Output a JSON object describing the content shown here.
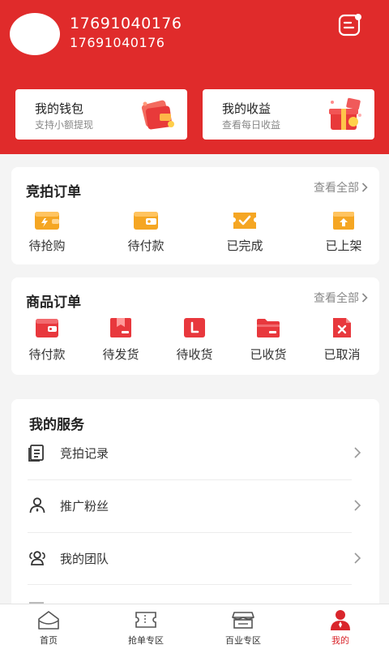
{
  "header": {
    "username": "17691040176",
    "phone": "17691040176"
  },
  "wallet": {
    "title": "我的钱包",
    "subtitle": "支持小额提现"
  },
  "earnings": {
    "title": "我的收益",
    "subtitle": "查看每日收益"
  },
  "auction_orders": {
    "title": "竞拍订单",
    "see_all": "查看全部",
    "items": [
      {
        "label": "待抢购",
        "icon": "wallet-clock-icon"
      },
      {
        "label": "待付款",
        "icon": "wallet-icon"
      },
      {
        "label": "已完成",
        "icon": "check-ticket-icon"
      },
      {
        "label": "已上架",
        "icon": "box-upload-icon"
      }
    ]
  },
  "product_orders": {
    "title": "商品订单",
    "see_all": "查看全部",
    "items": [
      {
        "label": "待付款",
        "icon": "wallet-icon"
      },
      {
        "label": "待发货",
        "icon": "package-icon"
      },
      {
        "label": "待收货",
        "icon": "receive-box-icon"
      },
      {
        "label": "已收货",
        "icon": "folder-icon"
      },
      {
        "label": "已取消",
        "icon": "cancel-doc-icon"
      }
    ]
  },
  "services": {
    "title": "我的服务",
    "items": [
      {
        "label": "竞拍记录",
        "icon": "document-list-icon"
      },
      {
        "label": "推广粉丝",
        "icon": "person-icon"
      },
      {
        "label": "我的团队",
        "icon": "team-icon"
      }
    ]
  },
  "tabbar": {
    "items": [
      {
        "label": "首页",
        "icon": "home-icon",
        "active": false
      },
      {
        "label": "抢单专区",
        "icon": "ticket-icon",
        "active": false
      },
      {
        "label": "百业专区",
        "icon": "store-icon",
        "active": false
      },
      {
        "label": "我的",
        "icon": "user-icon",
        "active": true
      }
    ]
  },
  "colors": {
    "brand_red": "#e02b2b",
    "active_red": "#d9262c",
    "icon_orange": "#f5a623"
  }
}
